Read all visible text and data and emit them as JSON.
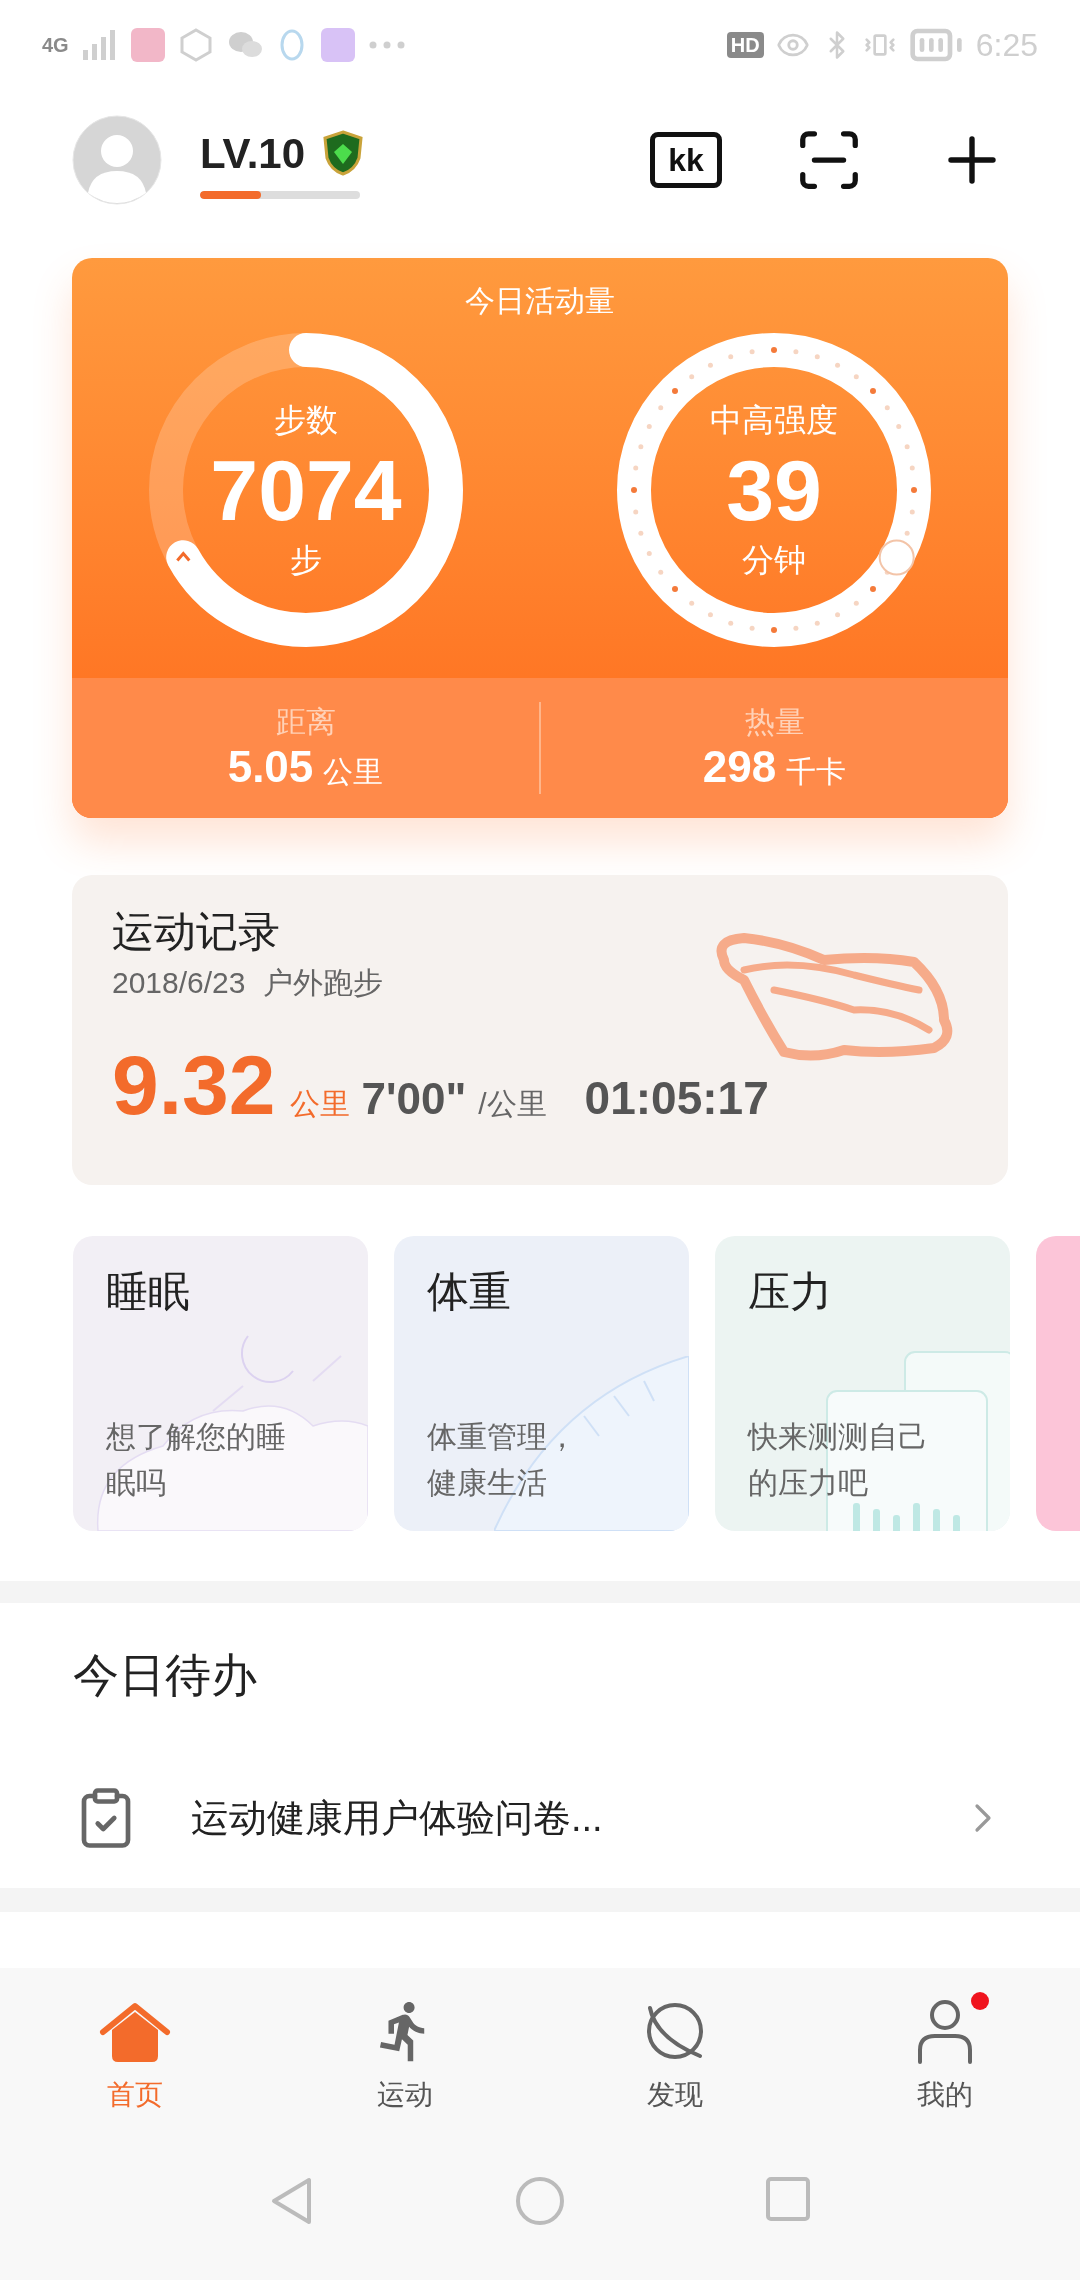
{
  "status_bar": {
    "network": "4G",
    "hd_label": "HD",
    "time": "6:25"
  },
  "header": {
    "level_label": "LV.10",
    "level_progress": {
      "level": 0.38
    },
    "ticket_label": "kk"
  },
  "activity": {
    "title": "今日活动量",
    "rings": [
      {
        "kind": "solid",
        "label": "步数",
        "value": "7074",
        "unit": "步"
      },
      {
        "kind": "dotted",
        "label": "中高强度",
        "value": "39",
        "unit": "分钟"
      }
    ],
    "stats": [
      {
        "label": "距离",
        "value": "5.05",
        "unit": "公里"
      },
      {
        "label": "热量",
        "value": "298",
        "unit": "千卡"
      }
    ]
  },
  "record": {
    "title": "运动记录",
    "date": "2018/6/23",
    "type": "户外跑步",
    "distance": "9.32",
    "distance_unit": "公里",
    "pace": "7'00\"",
    "pace_unit": "/公里",
    "duration": "01:05:17"
  },
  "feature_cards": [
    {
      "kind": "sleep",
      "title": "睡眠",
      "lines": [
        "想了解您的睡",
        "眠吗"
      ],
      "color": "#f2eff5"
    },
    {
      "kind": "weight",
      "title": "体重",
      "lines": [
        "体重管理，",
        "健康生活"
      ],
      "color": "#ecf0f8"
    },
    {
      "kind": "stress",
      "title": "压力",
      "lines": [
        "快来测测自己",
        "的压力吧"
      ],
      "color": "#ecf4f2"
    },
    {
      "kind": "blank",
      "color": "#fcc5d8"
    }
  ],
  "todo": {
    "title": "今日待办",
    "items": [
      {
        "text": "运动健康用户体验问卷..."
      }
    ]
  },
  "bottom_nav": [
    {
      "kind": "home",
      "label": "首页",
      "selected": true,
      "badge": false
    },
    {
      "kind": "run",
      "label": "运动",
      "selected": false,
      "badge": false
    },
    {
      "kind": "discover",
      "label": "发现",
      "selected": false,
      "badge": false
    },
    {
      "kind": "me",
      "label": "我的",
      "selected": false,
      "badge": true
    }
  ]
}
